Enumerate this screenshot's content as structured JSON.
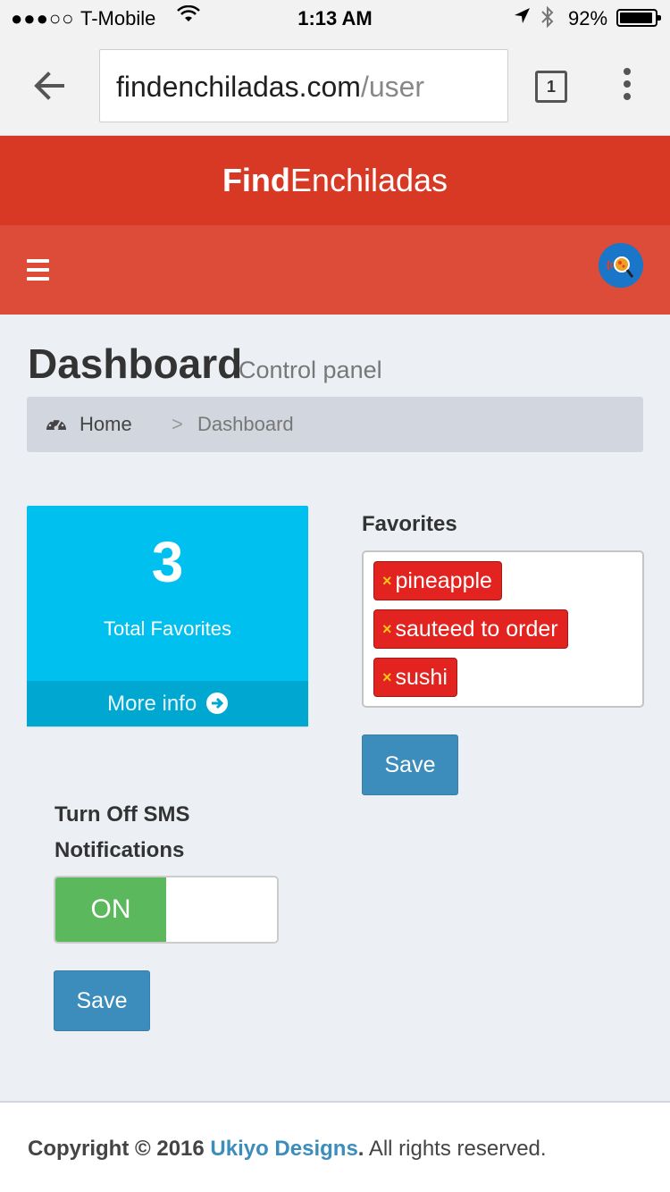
{
  "status_bar": {
    "signal": "●●●○○",
    "carrier": "T-Mobile",
    "time": "1:13 AM",
    "battery": "92%"
  },
  "browser": {
    "url_host": "findenchiladas.com",
    "url_path": "/user",
    "tab_count": "1"
  },
  "app": {
    "logo_bold": "Find",
    "logo_light": "Enchiladas"
  },
  "header": {
    "title": "Dashboard",
    "subtitle": "Control panel"
  },
  "breadcrumb": {
    "home": "Home",
    "separator": ">",
    "current": "Dashboard"
  },
  "stats": {
    "count": "3",
    "label": "Total Favorites",
    "more_info": "More info"
  },
  "favorites": {
    "label": "Favorites",
    "tags": [
      "pineapple",
      "sauteed to order",
      "sushi"
    ],
    "save": "Save"
  },
  "sms": {
    "label": "Turn Off SMS Notifications",
    "toggle_state": "ON",
    "save": "Save"
  },
  "footer": {
    "prefix": "Copyright © 2016",
    "brand": "Ukiyo Designs",
    "period": ".",
    "suffix": "All rights reserved."
  },
  "colors": {
    "logo_bar": "#d73925",
    "navbar": "#dd4b39",
    "stat_box": "#00c0ef",
    "tag": "#e3231f",
    "primary_button": "#3c8dbc",
    "toggle_on": "#5cb85c"
  }
}
